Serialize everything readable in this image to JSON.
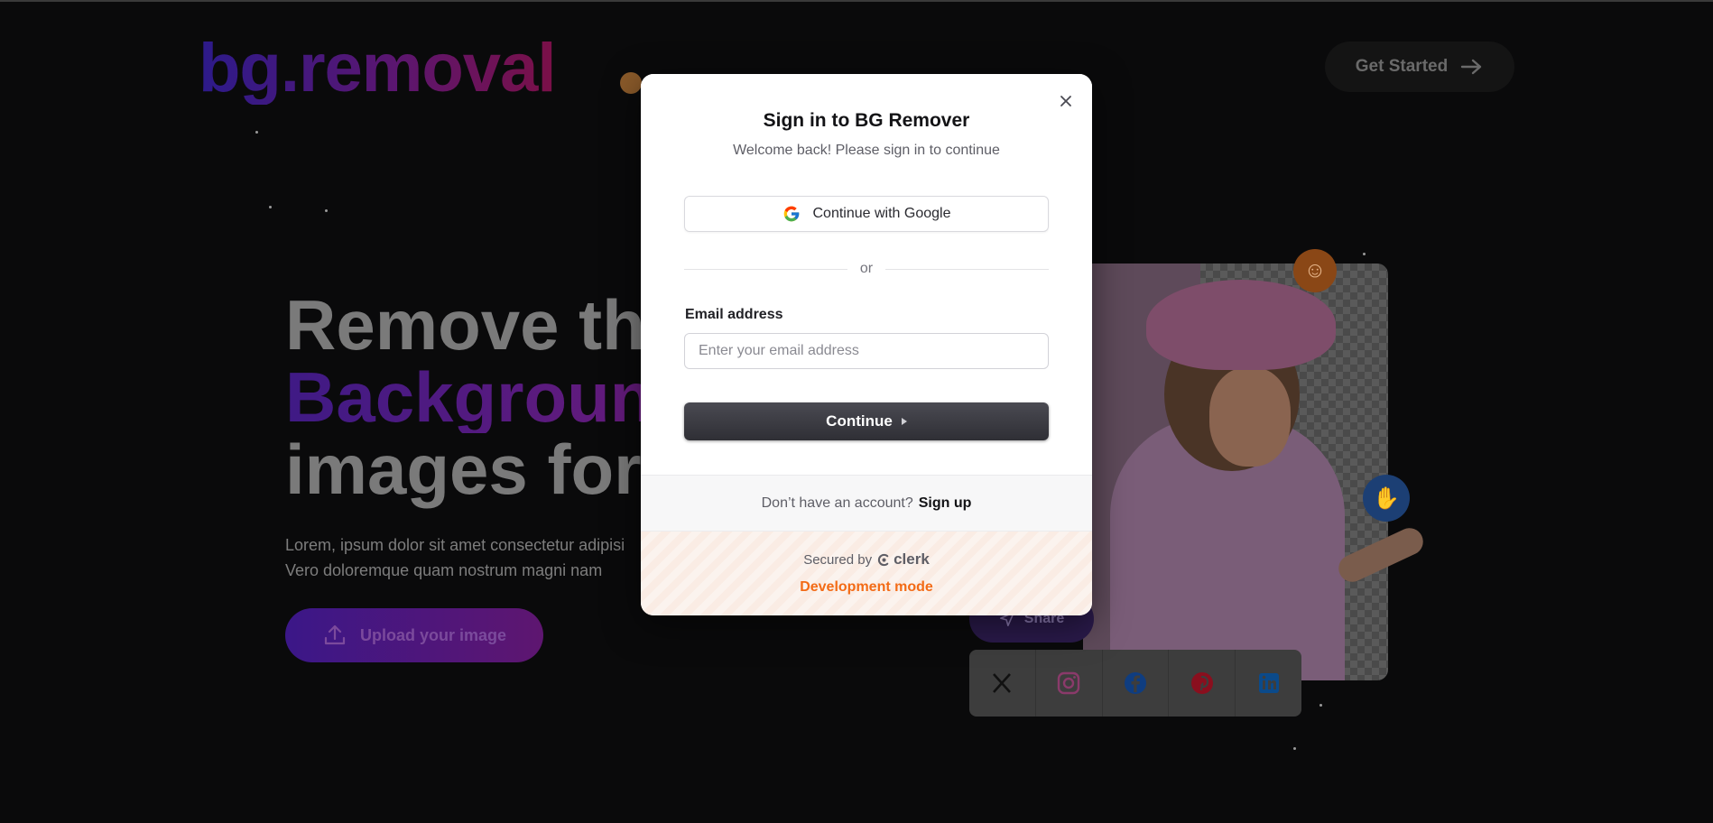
{
  "background": {
    "logo": "bg.removal",
    "get_started": "Get Started",
    "hero": {
      "line1": "Remove the",
      "line2": "Background",
      "line3": "images for"
    },
    "lorem_line1": "Lorem, ipsum dolor sit amet consectetur adipisi",
    "lorem_line2": "Vero doloremque quam nostrum magni nam",
    "upload_label": "Upload your image",
    "share_label": "Share",
    "social_icons": [
      "x-icon",
      "instagram-icon",
      "facebook-icon",
      "pinterest-icon",
      "linkedin-icon"
    ]
  },
  "modal": {
    "title": "Sign in to BG Remover",
    "subtitle": "Welcome back! Please sign in to continue",
    "google_button": "Continue with Google",
    "divider": "or",
    "email_label": "Email address",
    "email_placeholder": "Enter your email address",
    "email_value": "",
    "continue_button": "Continue",
    "footer_prompt": "Don’t have an account?",
    "footer_link": "Sign up",
    "secured_by": "Secured by",
    "clerk_name": "clerk",
    "dev_mode": "Development mode"
  },
  "colors": {
    "accent_orange": "#f36b16",
    "button_dark": "#2f2f35",
    "page_bg": "#0a0a0b",
    "logo_gradient_start": "#2c1a8a",
    "logo_gradient_end": "#7a1047"
  }
}
